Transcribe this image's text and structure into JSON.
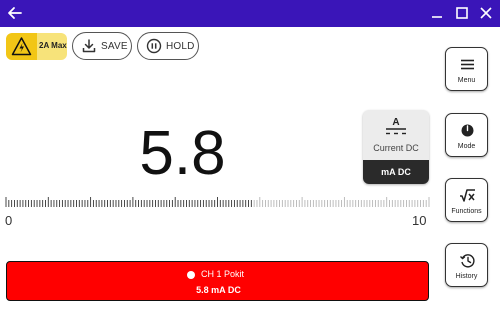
{
  "window": {
    "back_icon": "arrow-left-icon",
    "minimize_icon": "minimize-icon",
    "maximize_icon": "maximize-icon",
    "close_icon": "close-icon",
    "titlebar_color": "#3a15b8"
  },
  "toolbar": {
    "max_current_label": "2A Max",
    "warning_icon": "high-voltage-warning-icon",
    "save_label": "SAVE",
    "save_icon": "download-icon",
    "hold_label": "HOLD",
    "hold_icon": "pause-circle-icon"
  },
  "sidebar": {
    "items": [
      {
        "label": "Menu",
        "icon": "hamburger-menu-icon"
      },
      {
        "label": "Mode",
        "icon": "dial-knob-icon"
      },
      {
        "label": "Functions",
        "icon": "square-root-x-icon"
      },
      {
        "label": "History",
        "icon": "history-clock-icon"
      }
    ]
  },
  "display": {
    "reading": "5.8"
  },
  "mode_card": {
    "symbol_letter": "A",
    "symbol_icon": "dc-current-symbol-icon",
    "name": "Current DC",
    "unit": "mA DC"
  },
  "scale": {
    "min_label": "0",
    "max_label": "10",
    "reading_fraction": 0.58
  },
  "channel": {
    "name": "CH 1 Pokit",
    "value": "5.8 mA DC",
    "color": "#ff0000"
  }
}
